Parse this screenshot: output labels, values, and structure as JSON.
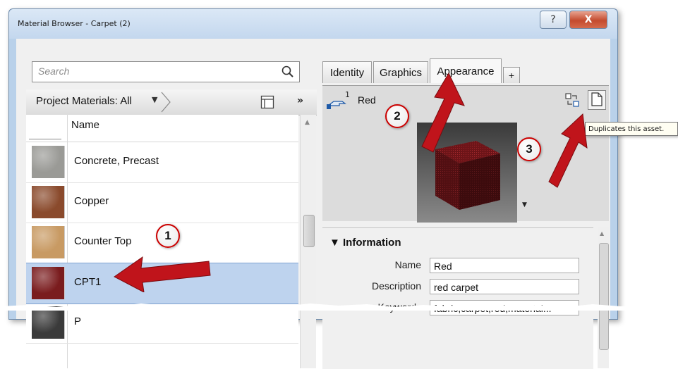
{
  "window": {
    "title": "Material Browser - Carpet (2)",
    "help_label": "?",
    "close_label": "X"
  },
  "left_panel": {
    "search_placeholder": "Search",
    "filter_label": "Project Materials: All",
    "more_label": "»",
    "column_name": "Name",
    "materials": [
      {
        "name": "Concrete, Precast",
        "swatch": "#9a9a96",
        "selected": false
      },
      {
        "name": "Copper",
        "swatch": "#8a4a2c",
        "selected": false
      },
      {
        "name": "Counter Top",
        "swatch": "#c89a63",
        "selected": false
      },
      {
        "name": "CPT1",
        "swatch": "#7a1c1e",
        "selected": true
      },
      {
        "name": "P",
        "swatch": "#3a3a3a",
        "selected": false
      }
    ]
  },
  "right_panel": {
    "tabs": [
      {
        "label": "Identity",
        "active": false
      },
      {
        "label": "Graphics",
        "active": false
      },
      {
        "label": "Appearance",
        "active": true
      },
      {
        "label": "+",
        "active": false
      }
    ],
    "asset_count": "1",
    "asset_name": "Red",
    "information": {
      "heading": "Information",
      "fields": [
        {
          "label": "Name",
          "value": "Red"
        },
        {
          "label": "Description",
          "value": "red carpet"
        },
        {
          "label": "Keywords",
          "value": "fabric,carpet,red,material..."
        }
      ]
    }
  },
  "tooltip": "Duplicates this asset.",
  "callouts": [
    "1",
    "2",
    "3"
  ],
  "colors": {
    "selection": "#bed3ee",
    "callout_arrow": "#c0141b"
  }
}
